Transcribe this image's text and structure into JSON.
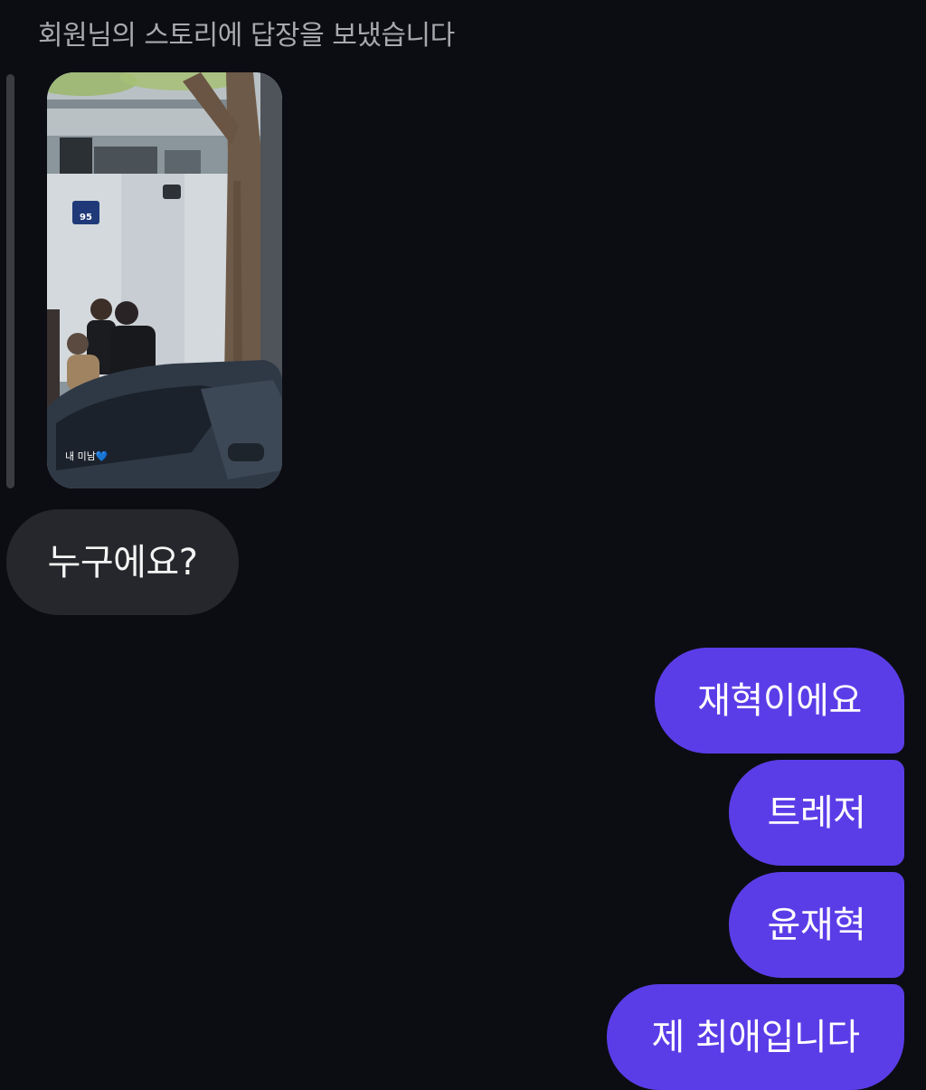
{
  "header": {
    "reply_context": "회원님의 스토리에 답장을 보냈습니다"
  },
  "story": {
    "caption": "내 미남💙",
    "sign_number": "95"
  },
  "messages": {
    "received": [
      {
        "text": "누구에요?"
      }
    ],
    "sent": [
      {
        "text": "재혁이에요"
      },
      {
        "text": "트레저"
      },
      {
        "text": "윤재혁"
      },
      {
        "text": "제 최애입니다"
      }
    ]
  },
  "colors": {
    "background": "#0c0d12",
    "received_bubble": "#26272c",
    "sent_bubble": "#5b3de8"
  }
}
